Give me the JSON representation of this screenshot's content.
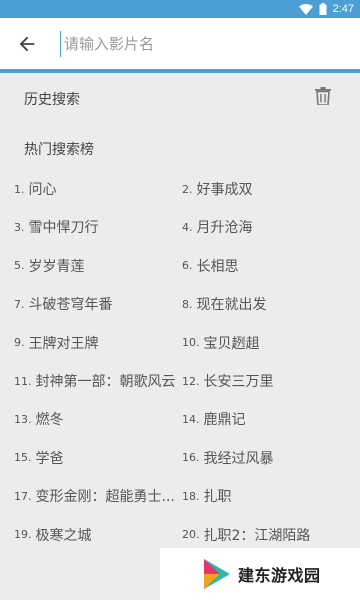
{
  "status_bar": {
    "time": "2:47",
    "wifi_icon": "wifi-icon",
    "battery_icon": "battery-icon"
  },
  "search": {
    "placeholder": "请输入影片名",
    "back_icon": "arrow-left-icon"
  },
  "history": {
    "title": "历史搜索",
    "clear_icon": "trash-icon"
  },
  "hot": {
    "title": "热门搜索榜",
    "items": [
      {
        "rank": "1.",
        "name": "问心"
      },
      {
        "rank": "2.",
        "name": "好事成双"
      },
      {
        "rank": "3.",
        "name": "雪中悍刀行"
      },
      {
        "rank": "4.",
        "name": "月升沧海"
      },
      {
        "rank": "5.",
        "name": "岁岁青莲"
      },
      {
        "rank": "6.",
        "name": "长相思"
      },
      {
        "rank": "7.",
        "name": "斗破苍穹年番"
      },
      {
        "rank": "8.",
        "name": "现在就出发"
      },
      {
        "rank": "9.",
        "name": "王牌对王牌"
      },
      {
        "rank": "10.",
        "name": "宝贝趔趄"
      },
      {
        "rank": "11.",
        "name": "封神第一部：朝歌风云"
      },
      {
        "rank": "12.",
        "name": "长安三万里"
      },
      {
        "rank": "13.",
        "name": "燃冬"
      },
      {
        "rank": "14.",
        "name": "鹿鼎记"
      },
      {
        "rank": "15.",
        "name": "学爸"
      },
      {
        "rank": "16.",
        "name": "我经过风暴"
      },
      {
        "rank": "17.",
        "name": "变形金刚：超能勇士..."
      },
      {
        "rank": "18.",
        "name": "扎职"
      },
      {
        "rank": "19.",
        "name": "极寒之城"
      },
      {
        "rank": "20.",
        "name": "扎职2：江湖陌路"
      }
    ]
  },
  "watermark": {
    "text": "建东游戏园",
    "logo_icon": "play-logo-icon"
  },
  "colors": {
    "accent": "#4b9fd5",
    "background": "#ececec",
    "text": "#555555"
  }
}
